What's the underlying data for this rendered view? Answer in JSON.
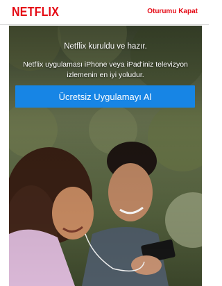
{
  "header": {
    "logo_text": "NETFLIX",
    "signout_label": "Oturumu Kapat"
  },
  "hero": {
    "title": "Netflix kuruldu ve hazır.",
    "body": "Netflix uygulaması iPhone veya iPad'iniz televizyon izlemenin en iyi yoludur.",
    "cta_label": "Ücretsiz Uygulamayı Al"
  },
  "colors": {
    "brand_red": "#e50914",
    "cta_blue": "#1785e5",
    "background": "#ffffff"
  }
}
